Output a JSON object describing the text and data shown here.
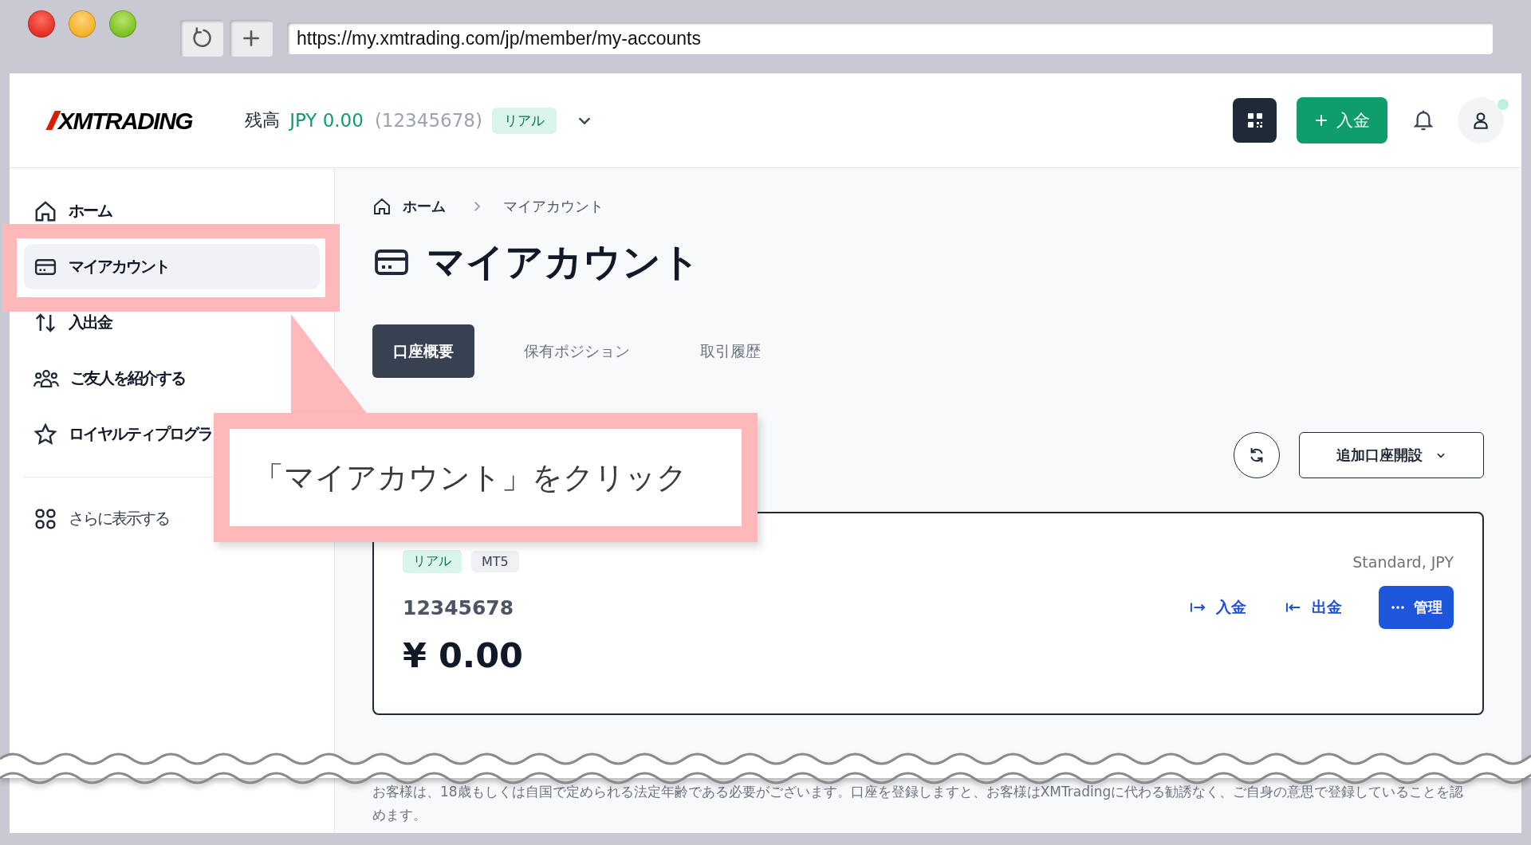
{
  "browser": {
    "url": "https://my.xmtrading.com/jp/member/my-accounts"
  },
  "header": {
    "logo": "XMTRADING",
    "balance_label": "残高",
    "balance": "JPY 0.00",
    "account_number": "(12345678)",
    "account_badge": "リアル",
    "deposit_button": "入金"
  },
  "sidebar": {
    "items": [
      {
        "label": "ホーム",
        "selected": false,
        "highlighted": false
      },
      {
        "label": "マイアカウント",
        "selected": true,
        "highlighted": true
      },
      {
        "label": "入出金",
        "selected": false,
        "highlighted": false
      },
      {
        "label": "ご友人を紹介する",
        "selected": false,
        "highlighted": false
      },
      {
        "label": "ロイヤルティプログラ",
        "selected": false,
        "highlighted": false
      }
    ],
    "more": "さらに表示する"
  },
  "breadcrumb": [
    "ホーム",
    "マイアカウント"
  ],
  "title": "マイアカウント",
  "tabs": [
    {
      "label": "口座概要",
      "selected": true
    },
    {
      "label": "保有ポジション",
      "selected": false
    },
    {
      "label": "取引履歴",
      "selected": false
    }
  ],
  "add_account_button": "追加口座開設",
  "account": {
    "tags": [
      {
        "label": "リアル",
        "color": "#dcf5ec"
      },
      {
        "label": "MT5",
        "color": "#eef0f3"
      }
    ],
    "type": "Standard, JPY",
    "number": "12345678",
    "balance": "¥ 0.00",
    "deposit": "入金",
    "withdraw": "出金",
    "manage": "管理"
  },
  "footer": "お客様は、18歳もしくは自国で定められる法定年齢である必要がございます。口座を登録しますと、お客様はXMTradingに代わる勧誘なく、ご自身の意思で登録していることを認めます。",
  "callout": {
    "text": "「マイアカウント」をクリック"
  }
}
